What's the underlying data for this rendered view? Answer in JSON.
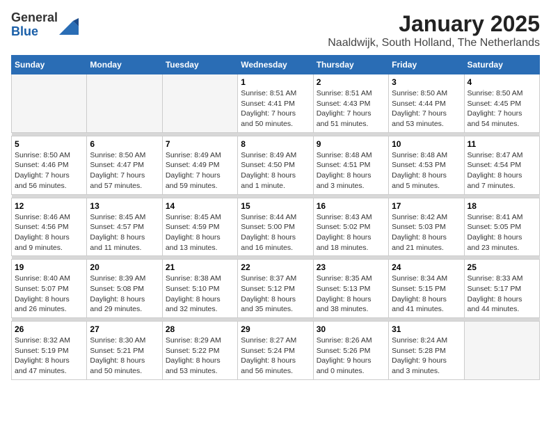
{
  "header": {
    "logo": {
      "general": "General",
      "blue": "Blue"
    },
    "title": "January 2025",
    "subtitle": "Naaldwijk, South Holland, The Netherlands"
  },
  "calendar": {
    "days_of_week": [
      "Sunday",
      "Monday",
      "Tuesday",
      "Wednesday",
      "Thursday",
      "Friday",
      "Saturday"
    ],
    "weeks": [
      {
        "days": [
          {
            "number": "",
            "info": ""
          },
          {
            "number": "",
            "info": ""
          },
          {
            "number": "",
            "info": ""
          },
          {
            "number": "1",
            "info": "Sunrise: 8:51 AM\nSunset: 4:41 PM\nDaylight: 7 hours\nand 50 minutes."
          },
          {
            "number": "2",
            "info": "Sunrise: 8:51 AM\nSunset: 4:43 PM\nDaylight: 7 hours\nand 51 minutes."
          },
          {
            "number": "3",
            "info": "Sunrise: 8:50 AM\nSunset: 4:44 PM\nDaylight: 7 hours\nand 53 minutes."
          },
          {
            "number": "4",
            "info": "Sunrise: 8:50 AM\nSunset: 4:45 PM\nDaylight: 7 hours\nand 54 minutes."
          }
        ]
      },
      {
        "days": [
          {
            "number": "5",
            "info": "Sunrise: 8:50 AM\nSunset: 4:46 PM\nDaylight: 7 hours\nand 56 minutes."
          },
          {
            "number": "6",
            "info": "Sunrise: 8:50 AM\nSunset: 4:47 PM\nDaylight: 7 hours\nand 57 minutes."
          },
          {
            "number": "7",
            "info": "Sunrise: 8:49 AM\nSunset: 4:49 PM\nDaylight: 7 hours\nand 59 minutes."
          },
          {
            "number": "8",
            "info": "Sunrise: 8:49 AM\nSunset: 4:50 PM\nDaylight: 8 hours\nand 1 minute."
          },
          {
            "number": "9",
            "info": "Sunrise: 8:48 AM\nSunset: 4:51 PM\nDaylight: 8 hours\nand 3 minutes."
          },
          {
            "number": "10",
            "info": "Sunrise: 8:48 AM\nSunset: 4:53 PM\nDaylight: 8 hours\nand 5 minutes."
          },
          {
            "number": "11",
            "info": "Sunrise: 8:47 AM\nSunset: 4:54 PM\nDaylight: 8 hours\nand 7 minutes."
          }
        ]
      },
      {
        "days": [
          {
            "number": "12",
            "info": "Sunrise: 8:46 AM\nSunset: 4:56 PM\nDaylight: 8 hours\nand 9 minutes."
          },
          {
            "number": "13",
            "info": "Sunrise: 8:45 AM\nSunset: 4:57 PM\nDaylight: 8 hours\nand 11 minutes."
          },
          {
            "number": "14",
            "info": "Sunrise: 8:45 AM\nSunset: 4:59 PM\nDaylight: 8 hours\nand 13 minutes."
          },
          {
            "number": "15",
            "info": "Sunrise: 8:44 AM\nSunset: 5:00 PM\nDaylight: 8 hours\nand 16 minutes."
          },
          {
            "number": "16",
            "info": "Sunrise: 8:43 AM\nSunset: 5:02 PM\nDaylight: 8 hours\nand 18 minutes."
          },
          {
            "number": "17",
            "info": "Sunrise: 8:42 AM\nSunset: 5:03 PM\nDaylight: 8 hours\nand 21 minutes."
          },
          {
            "number": "18",
            "info": "Sunrise: 8:41 AM\nSunset: 5:05 PM\nDaylight: 8 hours\nand 23 minutes."
          }
        ]
      },
      {
        "days": [
          {
            "number": "19",
            "info": "Sunrise: 8:40 AM\nSunset: 5:07 PM\nDaylight: 8 hours\nand 26 minutes."
          },
          {
            "number": "20",
            "info": "Sunrise: 8:39 AM\nSunset: 5:08 PM\nDaylight: 8 hours\nand 29 minutes."
          },
          {
            "number": "21",
            "info": "Sunrise: 8:38 AM\nSunset: 5:10 PM\nDaylight: 8 hours\nand 32 minutes."
          },
          {
            "number": "22",
            "info": "Sunrise: 8:37 AM\nSunset: 5:12 PM\nDaylight: 8 hours\nand 35 minutes."
          },
          {
            "number": "23",
            "info": "Sunrise: 8:35 AM\nSunset: 5:13 PM\nDaylight: 8 hours\nand 38 minutes."
          },
          {
            "number": "24",
            "info": "Sunrise: 8:34 AM\nSunset: 5:15 PM\nDaylight: 8 hours\nand 41 minutes."
          },
          {
            "number": "25",
            "info": "Sunrise: 8:33 AM\nSunset: 5:17 PM\nDaylight: 8 hours\nand 44 minutes."
          }
        ]
      },
      {
        "days": [
          {
            "number": "26",
            "info": "Sunrise: 8:32 AM\nSunset: 5:19 PM\nDaylight: 8 hours\nand 47 minutes."
          },
          {
            "number": "27",
            "info": "Sunrise: 8:30 AM\nSunset: 5:21 PM\nDaylight: 8 hours\nand 50 minutes."
          },
          {
            "number": "28",
            "info": "Sunrise: 8:29 AM\nSunset: 5:22 PM\nDaylight: 8 hours\nand 53 minutes."
          },
          {
            "number": "29",
            "info": "Sunrise: 8:27 AM\nSunset: 5:24 PM\nDaylight: 8 hours\nand 56 minutes."
          },
          {
            "number": "30",
            "info": "Sunrise: 8:26 AM\nSunset: 5:26 PM\nDaylight: 9 hours\nand 0 minutes."
          },
          {
            "number": "31",
            "info": "Sunrise: 8:24 AM\nSunset: 5:28 PM\nDaylight: 9 hours\nand 3 minutes."
          },
          {
            "number": "",
            "info": ""
          }
        ]
      }
    ]
  }
}
